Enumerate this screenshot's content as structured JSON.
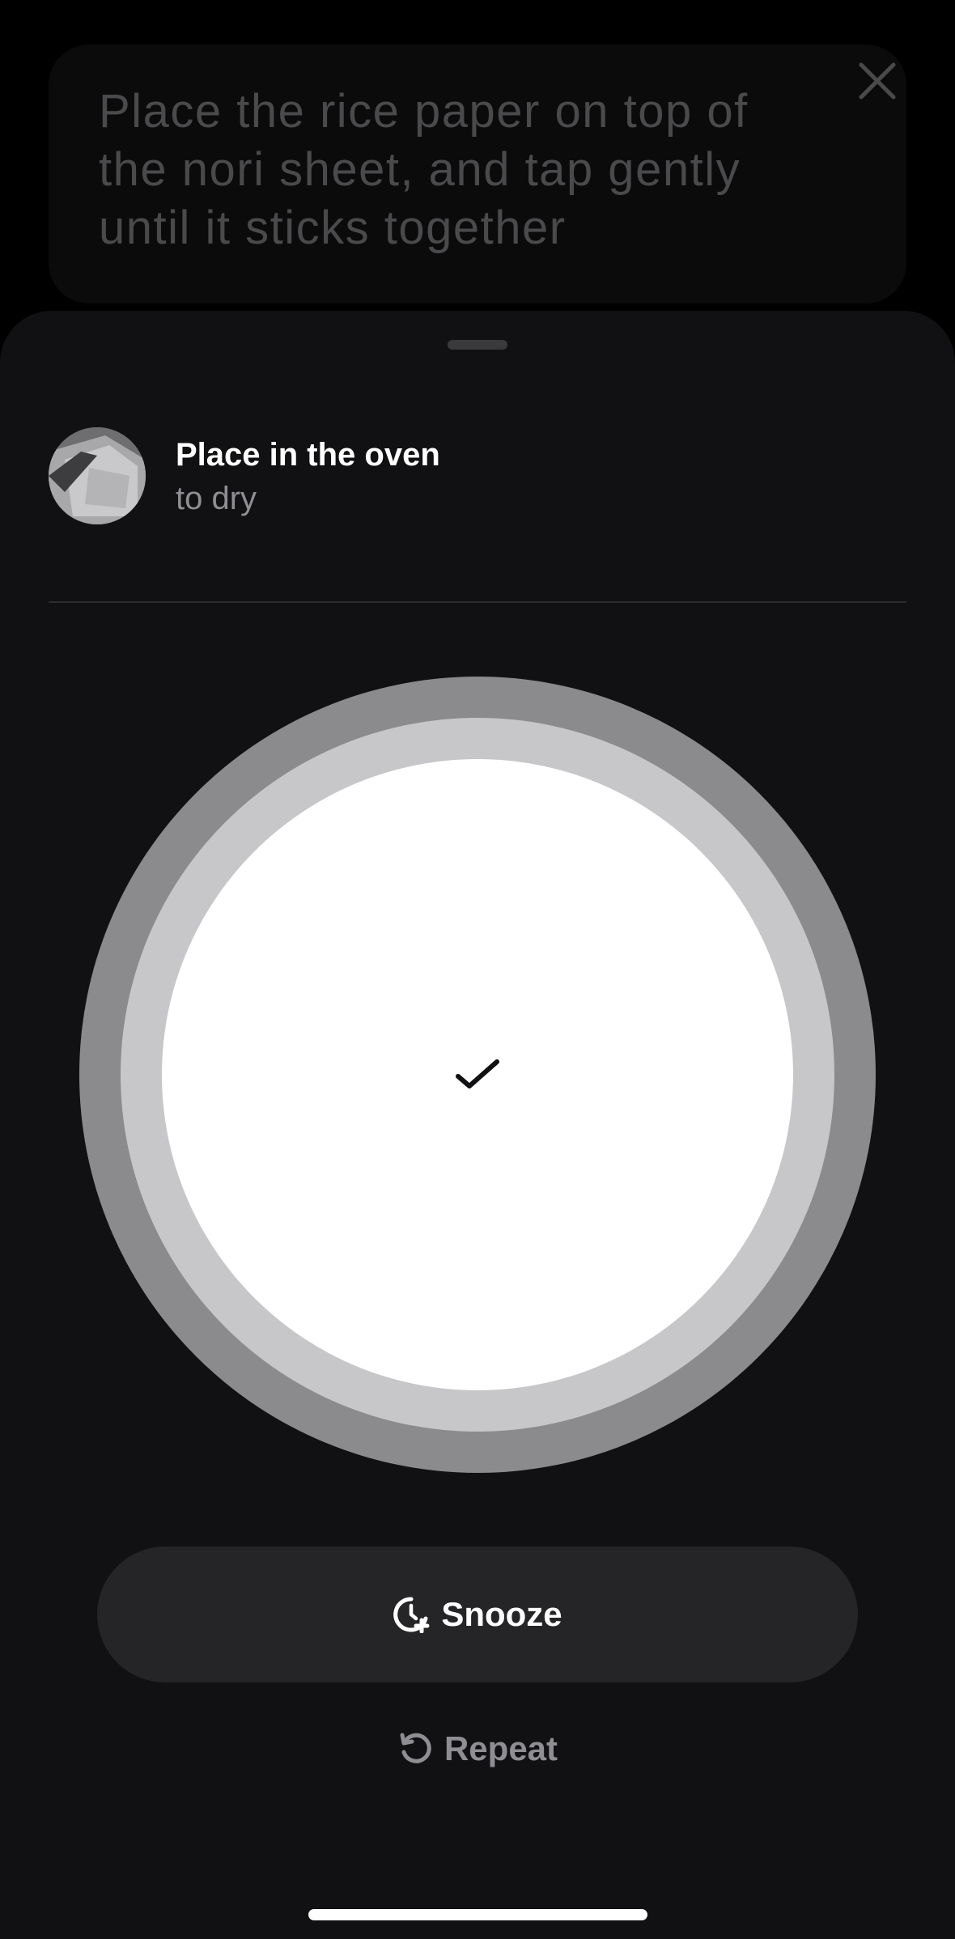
{
  "background_card": {
    "instruction": "Place the rice paper on top of the nori sheet, and tap gently until it sticks together",
    "close_icon": "close-icon"
  },
  "task": {
    "title": "Place in the oven",
    "subtitle": "to dry",
    "thumbnail": "oven-tray-image"
  },
  "complete_control": {
    "icon": "checkmark-icon",
    "colors": {
      "outer_ring": "#8b8b8e",
      "middle_ring": "#c7c7ca",
      "inner_fill": "#ffffff"
    }
  },
  "actions": {
    "snooze_label": "Snooze",
    "snooze_icon": "clock-plus-icon",
    "repeat_label": "Repeat",
    "repeat_icon": "repeat-icon"
  },
  "colors": {
    "background": "#000000",
    "sheet": "#111113",
    "snooze_button": "#252527",
    "secondary_text": "#8e8e93"
  }
}
